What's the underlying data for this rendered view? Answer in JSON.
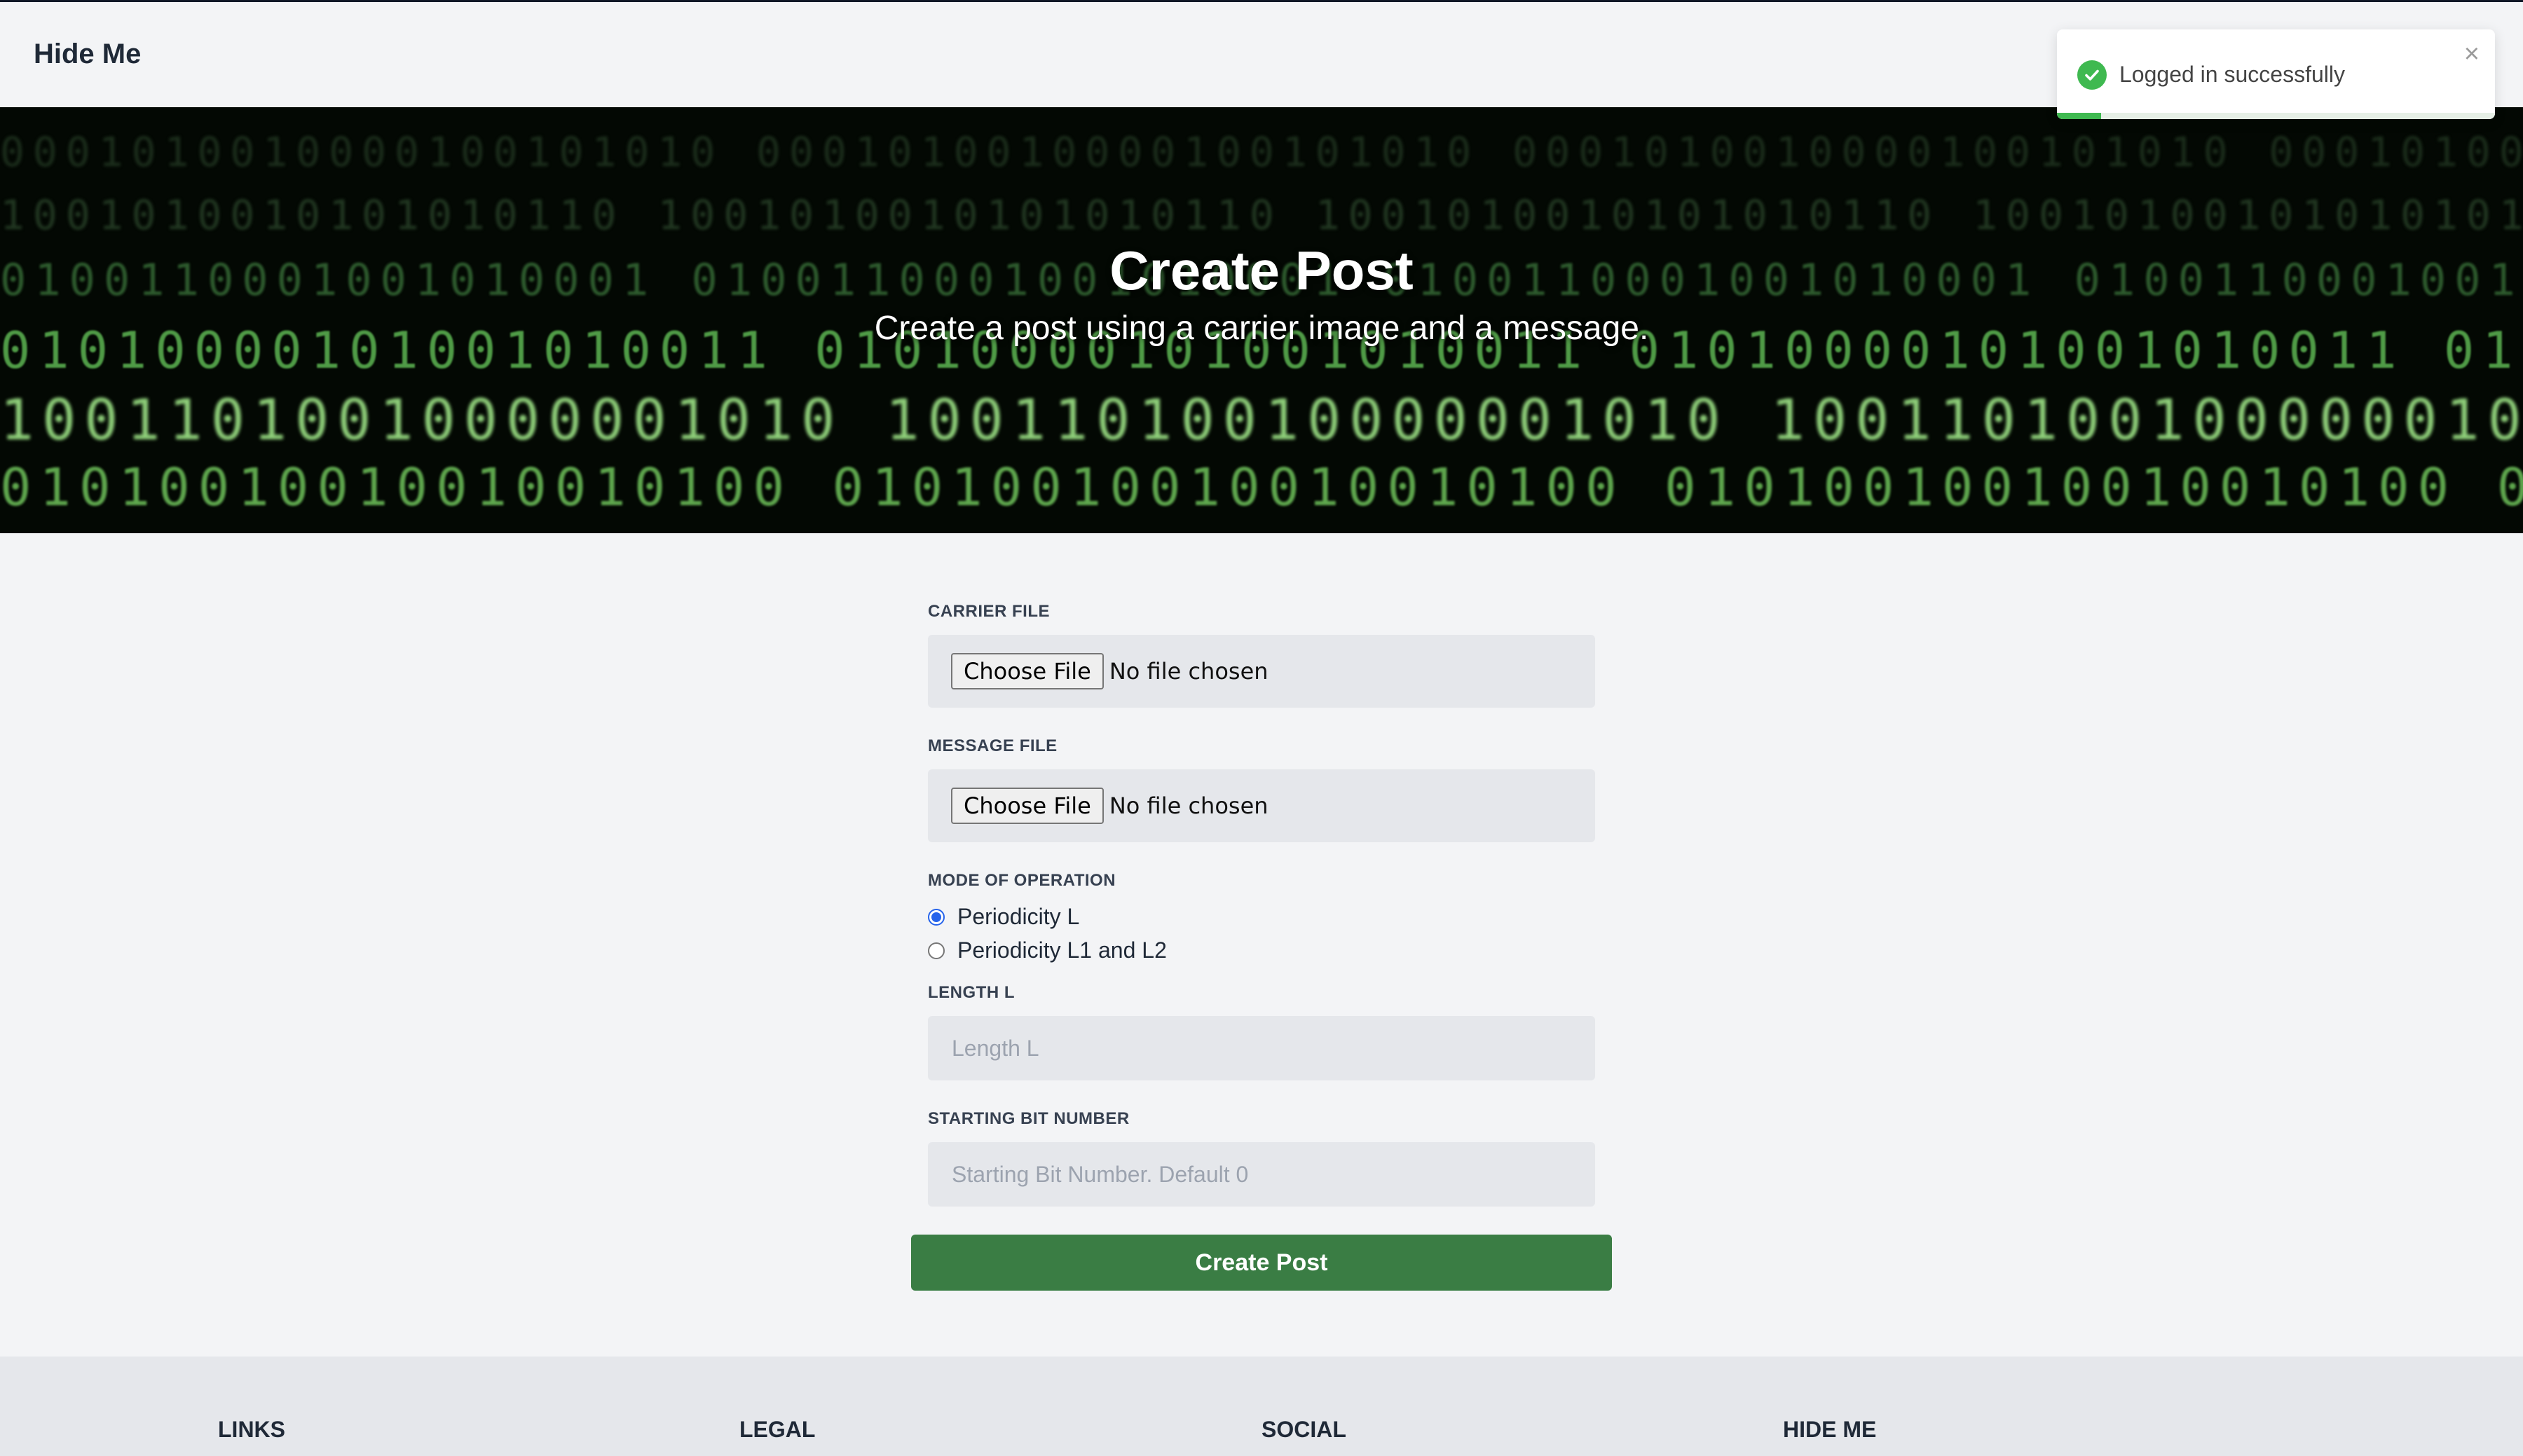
{
  "header": {
    "brand": "Hide Me"
  },
  "hero": {
    "title": "Create Post",
    "subtitle": "Create a post using a carrier image and a message.",
    "background_rows": [
      "0001010010000100101010",
      "1001010010101010110",
      "0100110001001010001",
      "01010000101001010011",
      "10011010010000001010",
      "01010010010010010100"
    ]
  },
  "toast": {
    "message": "Logged in successfully",
    "close_glyph": "×",
    "status_color": "#3fb950",
    "progress": 0.1
  },
  "form": {
    "carrier_file": {
      "label": "Carrier File",
      "button": "Choose File",
      "status": "No file chosen"
    },
    "message_file": {
      "label": "Message File",
      "button": "Choose File",
      "status": "No file chosen"
    },
    "mode": {
      "label": "Mode of Operation",
      "options": [
        {
          "label": "Periodicity L",
          "checked": true
        },
        {
          "label": "Periodicity L1 and L2",
          "checked": false
        }
      ]
    },
    "length_l": {
      "label": "Length L",
      "placeholder": "Length L",
      "value": ""
    },
    "starting_bit": {
      "label": "Starting Bit Number",
      "placeholder": "Starting Bit Number. Default 0",
      "value": ""
    },
    "submit_label": "Create Post",
    "submit_color": "#3a7d44"
  },
  "footer": {
    "columns": [
      {
        "heading": "Links"
      },
      {
        "heading": "Legal"
      },
      {
        "heading": "Social"
      },
      {
        "heading": "Hide Me"
      }
    ]
  }
}
